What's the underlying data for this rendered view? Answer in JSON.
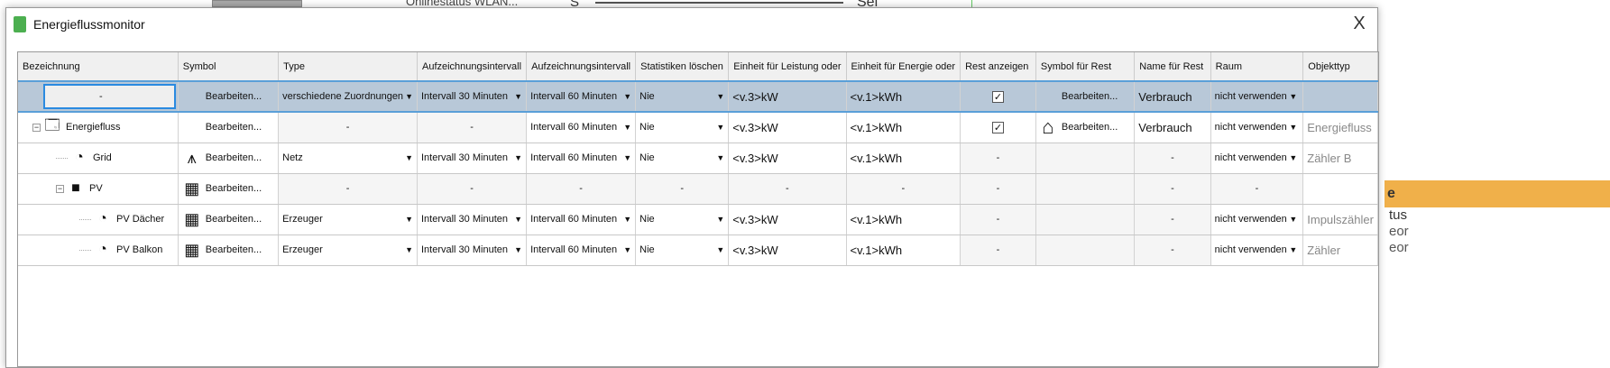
{
  "background": {
    "wlan_label": "Onlinestatus WLAN...",
    "s_label": "S",
    "sel_label": "Sel",
    "orange_label": "e",
    "right_texts": [
      "tus",
      "eor",
      "eor"
    ]
  },
  "dialog": {
    "title": "Energieflussmonitor",
    "close_label": "X"
  },
  "columns": [
    "Bezeichnung",
    "Symbol",
    "Type",
    "Aufzeichnungsintervall",
    "Aufzeichnungsintervall",
    "Statistiken löschen",
    "Einheit für Leistung oder",
    "Einheit für Energie oder",
    "Rest anzeigen",
    "Symbol für Rest",
    "Name für Rest",
    "Raum",
    "Objekttyp"
  ],
  "rows": [
    {
      "name": "-",
      "level": 0,
      "icon": "",
      "tree": "",
      "selected": true,
      "symbol": "Bearbeiten...",
      "symbol_icon": "",
      "type": "verschiedene Zuordnungen",
      "type_dd": true,
      "int1": "Intervall 30 Minuten",
      "int1_dd": true,
      "int2": "Intervall 60 Minuten",
      "int2_dd": true,
      "stat": "Nie",
      "stat_dd": true,
      "power": "<v.3>kW",
      "energy": "<v.1>kWh",
      "rest": "check",
      "rest_symbol": "Bearbeiten...",
      "rest_symbol_icon": "",
      "rest_name": "Verbrauch",
      "room": "nicht verwenden",
      "room_dd": true,
      "objtype": ""
    },
    {
      "name": "Energiefluss",
      "level": 0,
      "icon": "window-icon",
      "tree": "−",
      "symbol": "Bearbeiten...",
      "symbol_icon": "",
      "type": "-",
      "int1": "-",
      "int2": "Intervall 60 Minuten",
      "int2_dd": true,
      "stat": "Nie",
      "stat_dd": true,
      "power": "<v.3>kW",
      "energy": "<v.1>kWh",
      "rest": "check",
      "rest_symbol": "Bearbeiten...",
      "rest_symbol_icon": "house-icon",
      "rest_name": "Verbrauch",
      "room": "nicht verwenden",
      "room_dd": true,
      "objtype": "Energiefluss"
    },
    {
      "name": "Grid",
      "level": 1,
      "icon": "gauge-icon",
      "tree": "",
      "symbol": "Bearbeiten...",
      "symbol_icon": "power-pylon-icon",
      "type": "Netz",
      "type_dd": true,
      "int1": "Intervall 30 Minuten",
      "int1_dd": true,
      "int2": "Intervall 60 Minuten",
      "int2_dd": true,
      "stat": "Nie",
      "stat_dd": true,
      "power": "<v.3>kW",
      "energy": "<v.1>kWh",
      "rest": "-",
      "rest_symbol": "",
      "rest_name": "-",
      "room": "nicht verwenden",
      "room_dd": true,
      "objtype": "Zähler B"
    },
    {
      "name": "PV",
      "level": 1,
      "icon": "folder-icon",
      "tree": "−",
      "symbol": "Bearbeiten...",
      "symbol_icon": "solar-panel-icon",
      "type": "-",
      "int1": "-",
      "int2": "-",
      "stat": "-",
      "power": "-",
      "energy": "-",
      "rest": "-",
      "rest_symbol": "",
      "rest_name": "-",
      "room": "-",
      "objtype": ""
    },
    {
      "name": "PV Dächer",
      "level": 2,
      "icon": "gauge-icon",
      "tree": "",
      "symbol": "Bearbeiten...",
      "symbol_icon": "solar-panel-icon",
      "type": "Erzeuger",
      "type_dd": true,
      "int1": "Intervall 30 Minuten",
      "int1_dd": true,
      "int2": "Intervall 60 Minuten",
      "int2_dd": true,
      "stat": "Nie",
      "stat_dd": true,
      "power": "<v.3>kW",
      "energy": "<v.1>kWh",
      "rest": "-",
      "rest_symbol": "",
      "rest_name": "-",
      "room": "nicht verwenden",
      "room_dd": true,
      "objtype": "Impulszähler"
    },
    {
      "name": "PV Balkon",
      "level": 2,
      "icon": "gauge-icon",
      "tree": "",
      "symbol": "Bearbeiten...",
      "symbol_icon": "solar-panel-icon",
      "type": "Erzeuger",
      "type_dd": true,
      "int1": "Intervall 30 Minuten",
      "int1_dd": true,
      "int2": "Intervall 60 Minuten",
      "int2_dd": true,
      "stat": "Nie",
      "stat_dd": true,
      "power": "<v.3>kW",
      "energy": "<v.1>kWh",
      "rest": "-",
      "rest_symbol": "",
      "rest_name": "-",
      "room": "nicht verwenden",
      "room_dd": true,
      "objtype": "Zähler"
    }
  ]
}
